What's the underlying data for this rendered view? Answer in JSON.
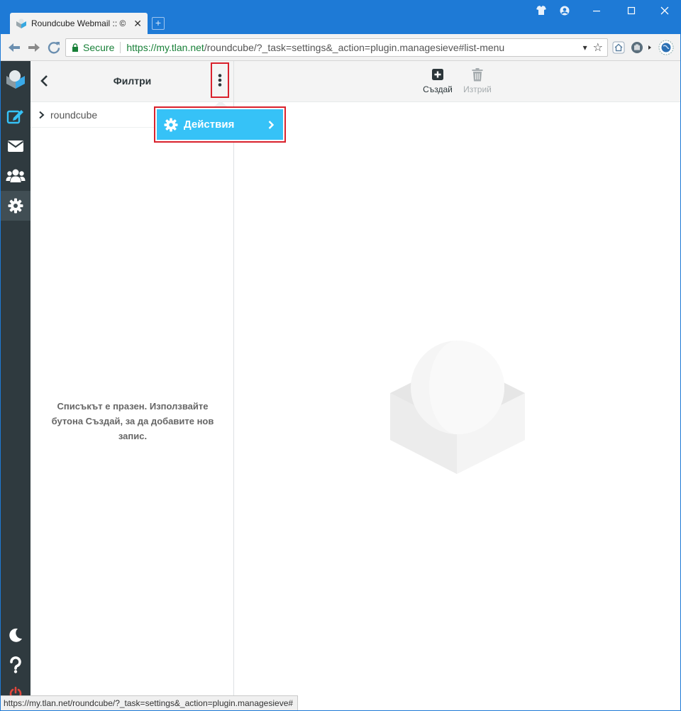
{
  "browser": {
    "tab_title": "Roundcube Webmail :: ©",
    "tab_close": "✕",
    "new_tab": "+",
    "address": {
      "secure_label": "Secure",
      "url_host": "https://my.tlan.net",
      "url_rest": "/roundcube/?_task=settings&_action=plugin.managesieve#list-menu",
      "dropdown_glyph": "▾",
      "star_glyph": "☆"
    },
    "status_url": "https://my.tlan.net/roundcube/?_task=settings&_action=plugin.managesieve#"
  },
  "rail": {
    "items": [
      {
        "name": "logo",
        "icon": "roundcube-logo-icon"
      },
      {
        "name": "compose",
        "icon": "compose-icon"
      },
      {
        "name": "mail",
        "icon": "envelope-icon"
      },
      {
        "name": "contacts",
        "icon": "users-icon"
      },
      {
        "name": "settings",
        "icon": "gear-icon",
        "active": true
      },
      {
        "name": "dark-mode",
        "icon": "moon-icon"
      },
      {
        "name": "help",
        "icon": "question-icon"
      },
      {
        "name": "logout",
        "icon": "power-icon"
      }
    ]
  },
  "left_pane": {
    "title": "Филтри",
    "filter_sets": [
      {
        "label": "roundcube"
      }
    ],
    "empty_message": "Списъкът е празен. Използвайте бутона Създай, за да добавите нов запис."
  },
  "popup": {
    "item_label": "Действия",
    "arrow": "›"
  },
  "main_toolbar": {
    "create_label": "Създай",
    "delete_label": "Изтрий"
  },
  "colors": {
    "accent": "#36c2f7",
    "rail_bg": "#2f3a3f",
    "highlight_border": "#d9212c",
    "title_bar": "#1e7ad6"
  }
}
